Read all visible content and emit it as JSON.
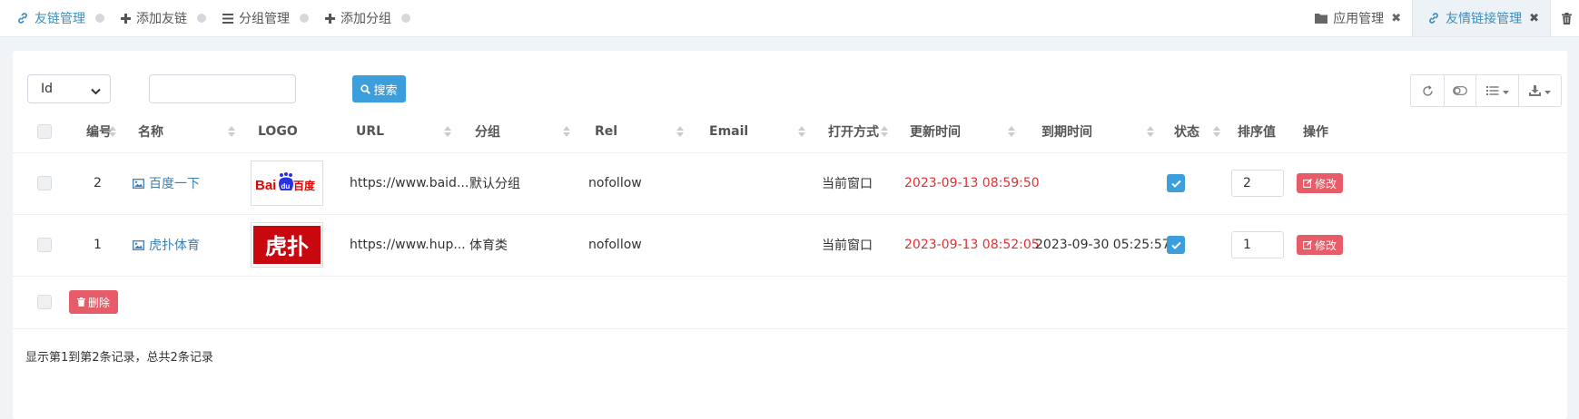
{
  "topbar": {
    "left_tabs": [
      {
        "label": "友链管理",
        "icon": "link-icon",
        "active": true
      },
      {
        "label": "添加友链",
        "icon": "plus-icon"
      },
      {
        "label": "分组管理",
        "icon": "list-icon"
      },
      {
        "label": "添加分组",
        "icon": "plus-icon"
      }
    ],
    "right_tabs": [
      {
        "label": "应用管理",
        "icon": "folder-icon",
        "close": "✖"
      },
      {
        "label": "友情链接管理",
        "icon": "link-icon",
        "close": "✖",
        "current": true
      }
    ],
    "trash_icon": "trash-icon"
  },
  "toolbar": {
    "field_select": {
      "selected": "Id"
    },
    "search_input": {
      "value": "",
      "placeholder": ""
    },
    "search_button": "搜索",
    "tools": [
      "refresh-icon",
      "toggle-icon",
      "columns-icon",
      "export-icon"
    ]
  },
  "table": {
    "columns": [
      "编号",
      "名称",
      "LOGO",
      "URL",
      "分组",
      "Rel",
      "Email",
      "打开方式",
      "更新时间",
      "到期时间",
      "状态",
      "排序值",
      "操作"
    ],
    "rows": [
      {
        "id": "2",
        "name": "百度一下",
        "logo_text": {
          "a": "Bai",
          "paw": "du",
          "b": "百度"
        },
        "url": "https://www.baid...",
        "group": "默认分组",
        "rel": "nofollow",
        "email": "",
        "open_mode": "当前窗口",
        "updated": "2023-09-13 08:59:50",
        "expires": "",
        "status": true,
        "sort": "2",
        "edit_label": "修改"
      },
      {
        "id": "1",
        "name": "虎扑体育",
        "logo_text": {
          "a": "虎扑"
        },
        "url": "https://www.hup...",
        "group": "体育类",
        "rel": "nofollow",
        "email": "",
        "open_mode": "当前窗口",
        "updated": "2023-09-13 08:52:05",
        "expires": "2023-09-30 05:25:57",
        "status": true,
        "sort": "1",
        "edit_label": "修改"
      }
    ],
    "delete_button": "删除"
  },
  "summary": "显示第1到第2条记录，总共2条记录",
  "colors": {
    "primary": "#3c9fdb",
    "danger": "#e65c68",
    "link": "#3c7fb5",
    "time_red": "#dd3333",
    "baidu_red": "#e10602",
    "baidu_blue": "#2932e1",
    "hupu_red": "#c8070e"
  }
}
